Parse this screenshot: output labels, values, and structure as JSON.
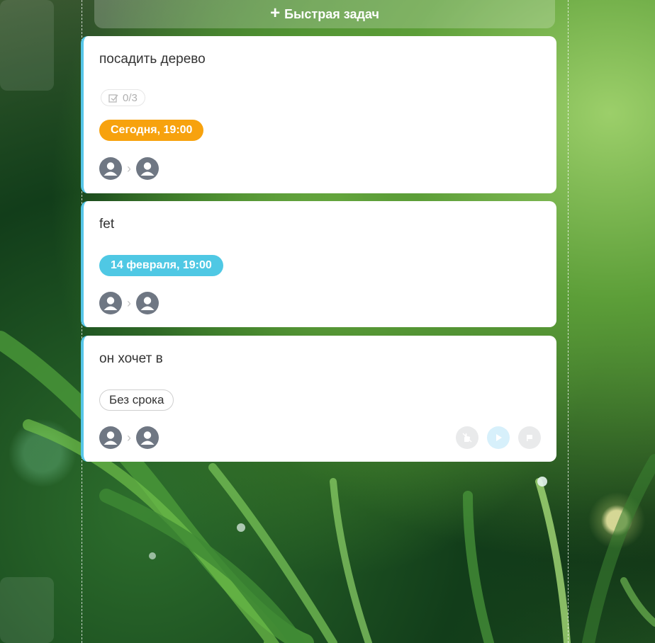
{
  "quick_add": {
    "label": "Быстрая задач"
  },
  "tasks": [
    {
      "title": "посадить дерево",
      "checklist": "0/3",
      "due": "Сегодня, 19:00",
      "due_color": "#f7a20e"
    },
    {
      "title": "fet",
      "due": "14 февраля, 19:00",
      "due_color": "#4fc8e4"
    },
    {
      "title": "он хочет в",
      "due": "Без срока"
    }
  ],
  "colors": {
    "card_accent": "#56c6e8",
    "avatar": "#6f7783",
    "action_grey": "#e9eaeb",
    "action_blue": "#d7f0fb"
  }
}
